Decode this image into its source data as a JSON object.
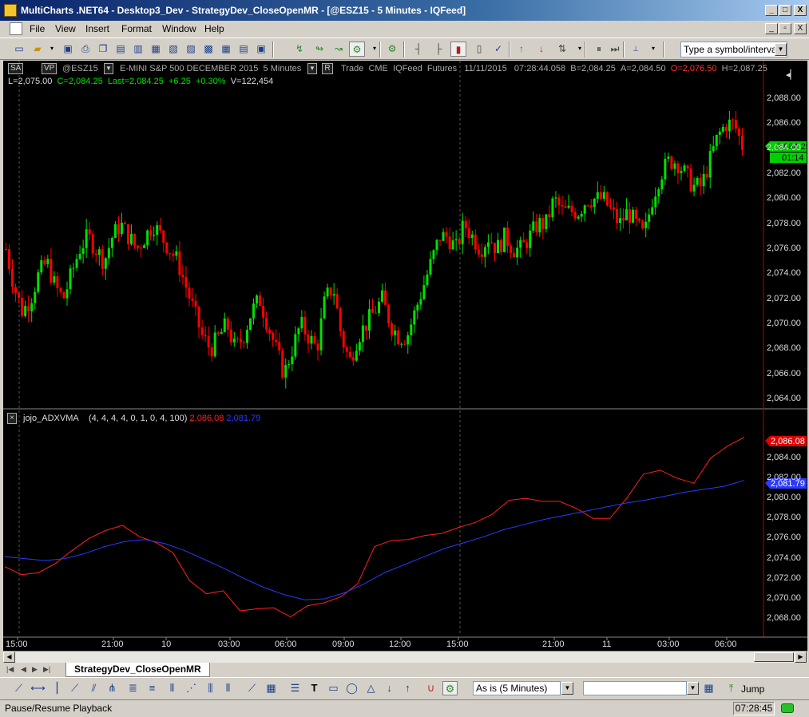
{
  "window": {
    "title": "MultiCharts .NET64 - Desktop3_Dev - StrategyDev_CloseOpenMR - [@ESZ15 - 5 Minutes - IQFeed]",
    "minimize": "_",
    "maximize": "□",
    "close": "X",
    "mdi_minimize": "_",
    "mdi_restore": "▫",
    "mdi_close": "X"
  },
  "menu": [
    "File",
    "View",
    "Insert",
    "Format",
    "Window",
    "Help"
  ],
  "toolbar": {
    "symbol_placeholder": "Type a symbol/interval"
  },
  "header": {
    "sa": "SA",
    "vp": "VP",
    "symbol": "@ESZ15",
    "description": "E-MINI S&P 500 DECEMBER 2015",
    "interval": "5 Minutes",
    "r_button": "R",
    "data_type": "Trade",
    "exchange": "CME",
    "feed": "IQFeed",
    "category": "Futures",
    "date": "11/11/2015",
    "time": "07:28:44.058",
    "bid": "B=2,084.25",
    "ask": "A=2,084.50",
    "open": "O=2,076.50",
    "high": "H=2,087.25",
    "low": "L=2,075.00",
    "close": "C=2,084.25",
    "last": "Last=2,084.25",
    "change": "+6.25",
    "change_pct": "+0.30%",
    "volume": "V=122,454"
  },
  "indicator": {
    "name": "jojo_ADXVMA",
    "params": "(4, 4, 4, 4, 0, 1, 0, 4, 100)",
    "value_red": "2,086.08",
    "value_blue": "2,081.79"
  },
  "price_axis_top": [
    "2,088.00",
    "2,086.00",
    "2,084.00",
    "2,082.00",
    "2,080.00",
    "2,078.00",
    "2,076.00",
    "2,074.00",
    "2,072.00",
    "2,070.00",
    "2,068.00",
    "2,066.00",
    "2,064.00"
  ],
  "price_axis_bottom": [
    "2,084.00",
    "2,082.00",
    "2,080.00",
    "2,078.00",
    "2,076.00",
    "2,074.00",
    "2,072.00",
    "2,070.00",
    "2,068.00"
  ],
  "last_price_tag": "2,084.25",
  "bar_timer": "01:14",
  "time_axis": [
    "15:00",
    "21:00",
    "10",
    "03:00",
    "06:00",
    "09:00",
    "12:00",
    "15:00",
    "21:00",
    "11",
    "03:00",
    "06:00"
  ],
  "tabs": {
    "active": "StrategyDev_CloseOpenMR"
  },
  "drawbar": {
    "resolution": "As is (5 Minutes)",
    "jump": "Jump"
  },
  "status": {
    "message": "Pause/Resume Playback",
    "clock": "07:28:45"
  },
  "colors": {
    "background": "#000000",
    "up_bar": "#00e000",
    "down_bar": "#ff0000",
    "indicator_red": "#ff2020",
    "indicator_blue": "#2a3aff",
    "axis_text": "#dddddd"
  },
  "chart_data": [
    {
      "type": "candlestick",
      "title": "@ESZ15 - 5 Minutes",
      "ylim": [
        2063.5,
        2089
      ],
      "close_path": [
        2076,
        2073,
        2071,
        2072,
        2074,
        2075,
        2073,
        2072,
        2074,
        2076,
        2077,
        2076,
        2075,
        2077,
        2078,
        2077,
        2076,
        2077,
        2078,
        2077,
        2076,
        2075,
        2073,
        2071,
        2069,
        2068,
        2069,
        2070,
        2068,
        2069,
        2071,
        2072,
        2070,
        2068,
        2066,
        2068,
        2070,
        2069,
        2068,
        2072,
        2073,
        2069,
        2067,
        2069,
        2070,
        2071,
        2072,
        2070,
        2069,
        2069,
        2071,
        2073,
        2075,
        2077,
        2077,
        2076,
        2078,
        2077,
        2076,
        2077,
        2076,
        2077,
        2076,
        2076,
        2077,
        2078,
        2078,
        2080,
        2079,
        2079,
        2079,
        2080,
        2080,
        2080,
        2079,
        2078,
        2079,
        2078,
        2077,
        2080,
        2082,
        2083,
        2083,
        2082,
        2081,
        2081,
        2083,
        2085,
        2086,
        2086,
        2084.25
      ]
    },
    {
      "type": "line",
      "title": "jojo_ADXVMA",
      "ylim": [
        2066.5,
        2087
      ],
      "series": [
        {
          "name": "2,086.08",
          "values": [
            2073.2,
            2072.4,
            2072.6,
            2073.5,
            2074.8,
            2076.0,
            2076.8,
            2077.3,
            2076.2,
            2075.6,
            2074.6,
            2071.8,
            2070.5,
            2070.8,
            2068.8,
            2069.0,
            2069.1,
            2068.2,
            2069.3,
            2069.6,
            2070.2,
            2071.5,
            2075.2,
            2075.8,
            2075.9,
            2076.3,
            2076.5,
            2077.1,
            2077.6,
            2078.4,
            2079.8,
            2080.0,
            2079.7,
            2079.7,
            2079.0,
            2078.0,
            2078.0,
            2080.0,
            2082.4,
            2082.8,
            2082.0,
            2081.5,
            2084.0,
            2085.2,
            2086.08
          ]
        },
        {
          "name": "2,081.79",
          "values": [
            2074.2,
            2074.0,
            2073.8,
            2074.0,
            2074.5,
            2075.2,
            2075.7,
            2075.9,
            2075.5,
            2074.8,
            2073.9,
            2073.0,
            2072.0,
            2071.1,
            2070.4,
            2069.9,
            2070.0,
            2070.6,
            2071.5,
            2072.6,
            2073.4,
            2074.2,
            2075.0,
            2075.6,
            2076.2,
            2076.9,
            2077.4,
            2077.9,
            2078.3,
            2078.7,
            2079.1,
            2079.5,
            2079.8,
            2080.2,
            2080.6,
            2080.9,
            2081.2,
            2081.79
          ]
        }
      ]
    }
  ]
}
